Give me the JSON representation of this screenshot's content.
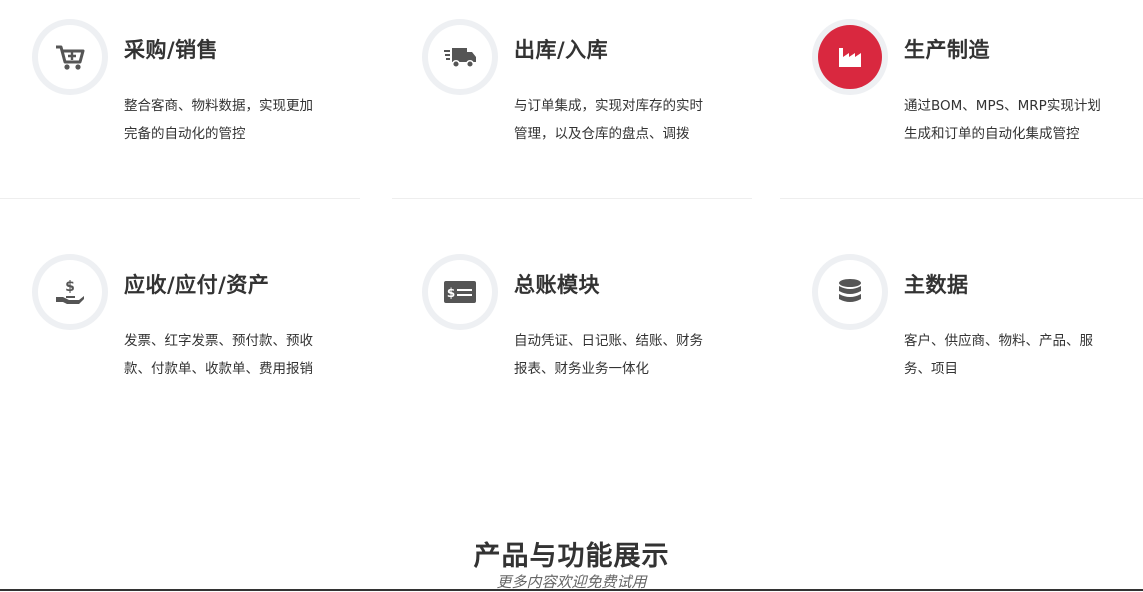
{
  "features": [
    {
      "title": "采购/销售",
      "desc": "整合客商、物料数据，实现更加完备的自动化的管控",
      "icon": "cart-plus-icon"
    },
    {
      "title": "出库/入库",
      "desc": "与订单集成，实现对库存的实时管理，以及仓库的盘点、调拨",
      "icon": "truck-icon"
    },
    {
      "title": "生产制造",
      "desc": "通过BOM、MPS、MRP实现计划生成和订单的自动化集成管控",
      "icon": "factory-icon",
      "active": true
    },
    {
      "title": "应收/应付/资产",
      "desc": "发票、红字发票、预付款、预收款、付款单、收款单、费用报销",
      "icon": "hand-dollar-icon"
    },
    {
      "title": "总账模块",
      "desc": "自动凭证、日记账、结账、财务报表、财务业务一体化",
      "icon": "money-card-icon"
    },
    {
      "title": "主数据",
      "desc": "客户、供应商、物料、产品、服务、项目",
      "icon": "database-icon"
    }
  ],
  "section": {
    "title": "产品与功能展示",
    "subtitle": "更多内容欢迎免费试用"
  },
  "colors": {
    "accent": "#d9283f",
    "icon": "#555555",
    "ring": "#eef0f3",
    "text": "#333333"
  }
}
